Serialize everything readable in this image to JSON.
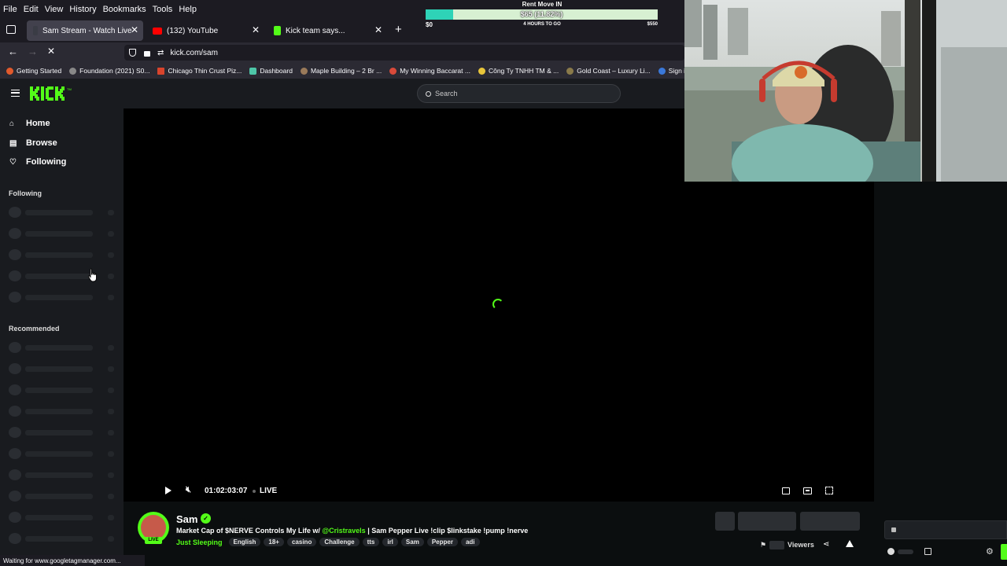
{
  "browser": {
    "menu": [
      "File",
      "Edit",
      "View",
      "History",
      "Bookmarks",
      "Tools",
      "Help"
    ],
    "tabs": [
      {
        "title": "Sam Stream - Watch Live on Ki",
        "active": true
      },
      {
        "title": "(132) YouTube",
        "active": false
      },
      {
        "title": "Kick team says...",
        "active": false
      }
    ],
    "url": "kick.com/sam",
    "bookmarks": [
      "Getting Started",
      "Foundation (2021) S0...",
      "Chicago Thin Crust Piz...",
      "Dashboard",
      "Maple Building – 2 Br ...",
      "My Winning Baccarat ...",
      "Công Ty TNHH TM & ...",
      "Gold Coast – Luxury Li...",
      "Sign in - Drea"
    ],
    "status": "Waiting for www.googletagmanager.com..."
  },
  "goal_overlay": {
    "title": "Rent Move IN",
    "amount": "$65 (11.82%)",
    "start": "$0",
    "middle": "4 HOURS TO GO",
    "end": "$550",
    "progress": 0.1182
  },
  "kick": {
    "search_placeholder": "Search",
    "nav": [
      {
        "label": "Home",
        "icon": "home-icon"
      },
      {
        "label": "Browse",
        "icon": "browse-icon"
      },
      {
        "label": "Following",
        "icon": "heart-icon"
      }
    ],
    "following_label": "Following",
    "recommended_label": "Recommended"
  },
  "player": {
    "time": "01:02:03:07",
    "live": "LIVE"
  },
  "stream": {
    "streamer": "Sam",
    "live_badge": "LIVE",
    "title_prefix": "Market Cap of $NERVE Controls My Life w/ ",
    "title_mention": "@Cristravels",
    "title_suffix": " | Sam Pepper Live !clip $linkstake !pump !nerve",
    "category": "Just Sleeping",
    "tags": [
      "English",
      "18+",
      "casino",
      "Challenge",
      "tts",
      "irl",
      "Sam",
      "Pepper",
      "adi"
    ],
    "viewers_label": "Viewers"
  },
  "colors": {
    "kick_green": "#53fc18",
    "goal_fill": "#2ed3b7"
  }
}
